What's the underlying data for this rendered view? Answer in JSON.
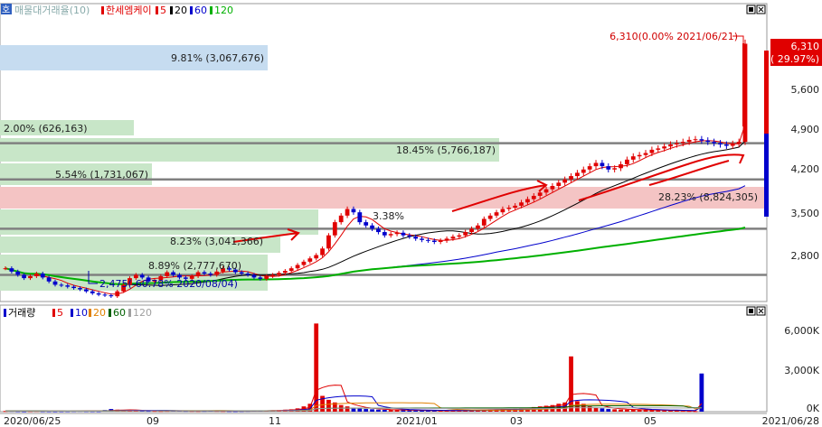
{
  "toolbar": {
    "menu_glyph": "호"
  },
  "price_panel": {
    "legend_prefix": "매물대거래율(10)",
    "legend_title": "한세엠케이",
    "ma_labels": [
      "5",
      "20",
      "60",
      "120"
    ],
    "ma_colors": [
      "#e00000",
      "#000000",
      "#0000cc",
      "#00b000"
    ],
    "volume_profile_labels": [
      "9.81% (3,067,676)",
      "2.00% (626,163)",
      "18.45% (5,766,187)",
      "5.54% (1,731,067)",
      "28.23% (8,824,305)",
      "8.23% (3,041,366)",
      "8.89% (2,777,670)"
    ],
    "stray_label": "3.38%",
    "max_annotation": "6,310(0.00% 2021/06/21)",
    "min_annotation": "2,475(-60.78% 2020/08/04)",
    "current_price": "6,310",
    "current_change": "( 29.97%)",
    "y_ticks": [
      "5,600",
      "4,900",
      "4,200",
      "3,500",
      "2,800"
    ]
  },
  "volume_panel": {
    "legend_title": "거래량",
    "ma_labels": [
      "5",
      "10",
      "20",
      "60",
      "120"
    ],
    "ma_colors": [
      "#e00000",
      "#0000cc",
      "#e08000",
      "#006000",
      "#a0a0a0"
    ],
    "y_ticks": [
      "6,000K",
      "3,000K",
      "0K"
    ]
  },
  "x_axis": {
    "ticks": [
      "2020/06/25",
      "09",
      "11",
      "2021/01",
      "03",
      "05",
      "2021/06/28"
    ]
  },
  "colors": {
    "up": "#e00000",
    "down": "#0000cc",
    "ma120": "#00c000",
    "profile_green": "#c8e6c8",
    "profile_blue": "#c6dcf0",
    "profile_red": "#f4c4c4"
  },
  "chart_data": {
    "type": "candlestick",
    "title": "한세엠케이",
    "x_start": "2020/06/25",
    "x_end": "2021/06/28",
    "ylim": [
      2450,
      6700
    ],
    "price_lines": [
      2800,
      3500,
      4250,
      4800
    ],
    "closes": [
      2900,
      2850,
      2800,
      2750,
      2780,
      2820,
      2760,
      2700,
      2650,
      2640,
      2620,
      2600,
      2580,
      2550,
      2520,
      2500,
      2490,
      2475,
      2550,
      2650,
      2750,
      2800,
      2760,
      2700,
      2720,
      2780,
      2840,
      2800,
      2760,
      2740,
      2780,
      2840,
      2820,
      2800,
      2850,
      2900,
      2880,
      2840,
      2820,
      2800,
      2760,
      2740,
      2780,
      2800,
      2830,
      2860,
      2900,
      2950,
      3000,
      3050,
      3100,
      3200,
      3400,
      3600,
      3700,
      3800,
      3750,
      3600,
      3550,
      3500,
      3450,
      3400,
      3420,
      3440,
      3400,
      3380,
      3350,
      3330,
      3320,
      3300,
      3320,
      3350,
      3380,
      3400,
      3450,
      3500,
      3550,
      3650,
      3700,
      3750,
      3800,
      3820,
      3850,
      3900,
      3950,
      4000,
      4050,
      4100,
      4150,
      4200,
      4250,
      4300,
      4350,
      4400,
      4450,
      4500,
      4450,
      4400,
      4420,
      4480,
      4550,
      4600,
      4620,
      4650,
      4700,
      4720,
      4750,
      4780,
      4800,
      4820,
      4850,
      4860,
      4840,
      4820,
      4800,
      4780,
      4760,
      4790,
      4820,
      6310
    ],
    "volume_k": [
      50,
      60,
      40,
      30,
      45,
      55,
      40,
      35,
      30,
      35,
      40,
      50,
      60,
      45,
      40,
      35,
      120,
      200,
      150,
      120,
      90,
      80,
      70,
      60,
      55,
      50,
      60,
      80,
      70,
      60,
      55,
      50,
      60,
      70,
      60,
      50,
      45,
      40,
      50,
      60,
      70,
      80,
      90,
      100,
      120,
      150,
      180,
      250,
      400,
      600,
      6700,
      1200,
      900,
      700,
      500,
      400,
      300,
      250,
      200,
      180,
      150,
      140,
      130,
      120,
      110,
      100,
      90,
      85,
      80,
      75,
      70,
      80,
      90,
      100,
      110,
      120,
      130,
      140,
      160,
      180,
      200,
      220,
      250,
      280,
      300,
      350,
      400,
      450,
      500,
      600,
      700,
      4200,
      800,
      600,
      400,
      300,
      250,
      200,
      180,
      160,
      150,
      140,
      130,
      120,
      110,
      100,
      90,
      80,
      70,
      60,
      50,
      40,
      2900
    ],
    "ma_series": [
      {
        "name": "5",
        "color": "#e00000"
      },
      {
        "name": "20",
        "color": "#000000"
      },
      {
        "name": "60",
        "color": "#0000cc"
      },
      {
        "name": "120",
        "color": "#00b000"
      }
    ]
  }
}
